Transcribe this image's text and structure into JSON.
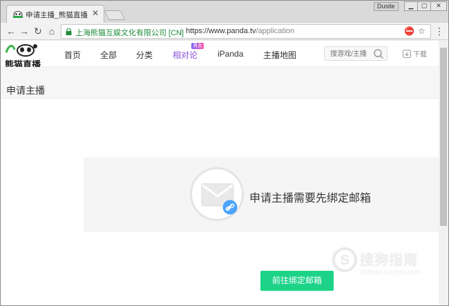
{
  "browser": {
    "tab": {
      "title": "申请主播_熊猫直播_泛娱"
    },
    "profile_label": "Dusite",
    "window_buttons": {
      "minimize": "▁",
      "restore": "▢",
      "close": "✕"
    },
    "cert_text": "上海熊猫互娱文化有限公司 [CN]",
    "url_host": "https://www.panda.tv",
    "url_path": "/application"
  },
  "site": {
    "logo_text": "熊猫直播",
    "nav": [
      {
        "label": "首页"
      },
      {
        "label": "全部"
      },
      {
        "label": "分类"
      },
      {
        "label": "相对论",
        "badge": "男女"
      },
      {
        "label": "iPanda"
      },
      {
        "label": "主播地图"
      }
    ],
    "search_placeholder": "搜游戏/主播",
    "download_label": "下载"
  },
  "page": {
    "title": "申请主播",
    "notice": "申请主播需要先绑定邮箱",
    "bind_button": "前往绑定邮箱"
  },
  "watermark": {
    "text": "搜狗指南",
    "sub": "zhinan.sogou.com"
  },
  "colors": {
    "accent_green": "#1cd388",
    "nav_active": "#8a4fd8",
    "cert_green": "#1e8c3b"
  }
}
